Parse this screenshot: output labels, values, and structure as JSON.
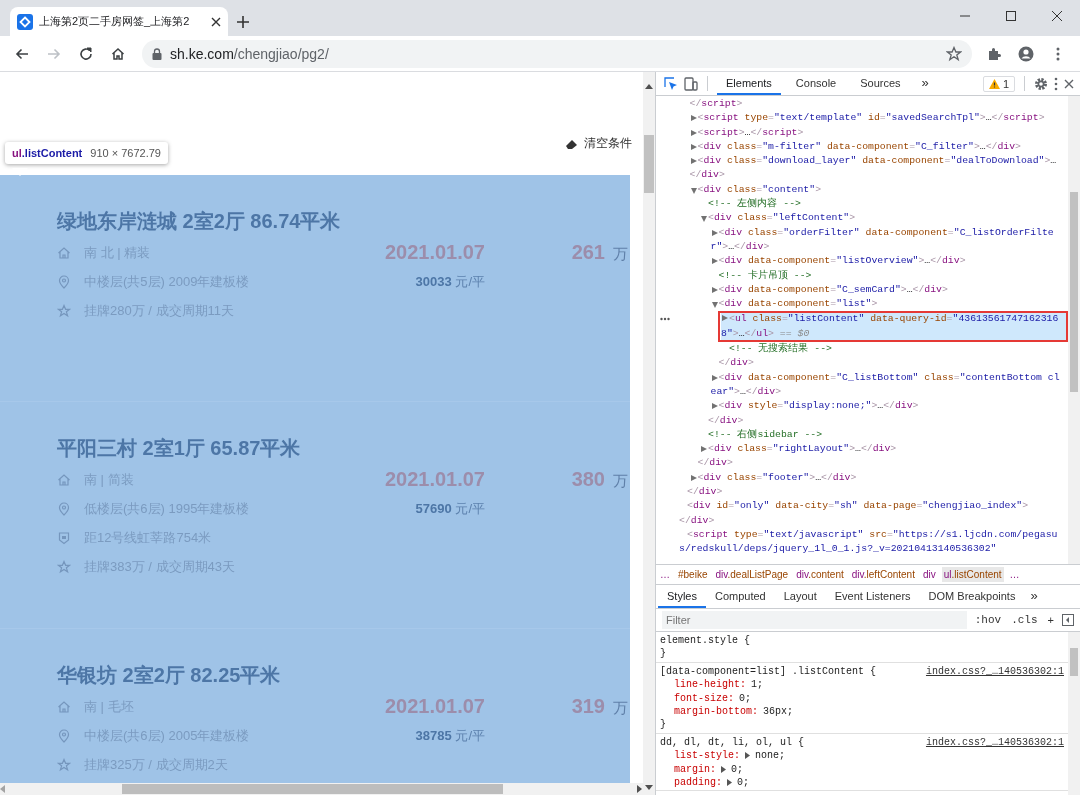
{
  "browser": {
    "tab": {
      "title": "上海第2页二手房网签_上海第2"
    },
    "nav": [
      {
        "kind": "back",
        "disabled": false
      },
      {
        "kind": "forward",
        "disabled": true
      },
      {
        "kind": "reload",
        "disabled": false
      },
      {
        "kind": "home",
        "disabled": false
      }
    ],
    "address": {
      "domain": "sh.ke.com",
      "path": "/chengjiao/pg2/"
    }
  },
  "page": {
    "clear_filters": "清空条件",
    "inspect_tooltip": {
      "selector": "ul.listContent",
      "size": "910 × 7672.79"
    },
    "listings": [
      {
        "title": "绿地东岸涟城 2室2厅 86.74平米",
        "rows": [
          {
            "kind": "house",
            "text": "南 北 | 精装"
          },
          {
            "kind": "location",
            "text": "中楼层(共5层) 2009年建板楼"
          },
          {
            "kind": "star",
            "text": "挂牌280万 / 成交周期11天"
          }
        ],
        "deal_date": "2021.01.07",
        "price": "261",
        "price_unit": "万",
        "unit_price": "30033",
        "unit_price_suffix": "元/平"
      },
      {
        "title": "平阳三村 2室1厅 65.87平米",
        "rows": [
          {
            "kind": "house",
            "text": "南 | 简装"
          },
          {
            "kind": "location",
            "text": "低楼层(共6层) 1995年建板楼"
          },
          {
            "kind": "subway",
            "text": "距12号线虹莘路754米"
          },
          {
            "kind": "star",
            "text": "挂牌383万 / 成交周期43天"
          }
        ],
        "deal_date": "2021.01.07",
        "price": "380",
        "price_unit": "万",
        "unit_price": "57690",
        "unit_price_suffix": "元/平"
      },
      {
        "title": "华银坊 2室2厅 82.25平米",
        "rows": [
          {
            "kind": "house",
            "text": "南 | 毛坯"
          },
          {
            "kind": "location",
            "text": "中楼层(共6层) 2005年建板楼"
          },
          {
            "kind": "star",
            "text": "挂牌325万 / 成交周期2天"
          }
        ],
        "deal_date": "2021.01.07",
        "price": "319",
        "price_unit": "万",
        "unit_price": "38785",
        "unit_price_suffix": "元/平"
      }
    ]
  },
  "devtools": {
    "tabs": [
      {
        "label": "Elements",
        "selected": true
      },
      {
        "label": "Console",
        "selected": false
      },
      {
        "label": "Sources",
        "selected": false
      }
    ],
    "more_tabs": "»",
    "warnings": "1",
    "dom": [
      {
        "children": [
          {
            "kind": "continuation",
            "selected": false,
            "lines": [
              "</script>"
            ]
          },
          {
            "kind": "element",
            "expanded": false,
            "selected": false,
            "lines": [
              "<script type=\"text/template\" id=\"savedSearchTpl\">…</script>"
            ]
          },
          {
            "kind": "element",
            "expanded": false,
            "selected": false,
            "lines": [
              "<script>…</script>"
            ]
          },
          {
            "kind": "element",
            "expanded": false,
            "selected": false,
            "lines": [
              "<div class=\"m-filter\" data-component=\"C_filter\">…</div>"
            ]
          },
          {
            "kind": "element",
            "expanded": false,
            "selected": false,
            "lines": [
              "<div class=\"download_layer\" data-component=\"dealToDownload\">…",
              "</div>"
            ]
          },
          {
            "kind": "element",
            "expanded": true,
            "selected": false,
            "lines": [
              "<div class=\"content\">"
            ],
            "closing": "</div>",
            "children": [
              {
                "kind": "comment",
                "selected": false,
                "lines": [
                  "<!-- 左侧内容 -->"
                ]
              },
              {
                "kind": "element",
                "expanded": true,
                "selected": false,
                "lines": [
                  "<div class=\"leftContent\">"
                ],
                "closing": "</div>",
                "children": [
                  {
                    "kind": "element",
                    "expanded": false,
                    "selected": false,
                    "lines": [
                      "<div class=\"orderFilter\" data-component=\"C_listOrderFilte",
                      "r\">…</div>"
                    ]
                  },
                  {
                    "kind": "element",
                    "expanded": false,
                    "selected": false,
                    "lines": [
                      "<div data-component=\"listOverview\">…</div>"
                    ]
                  },
                  {
                    "kind": "comment",
                    "selected": false,
                    "lines": [
                      "<!-- 卡片吊顶 -->"
                    ]
                  },
                  {
                    "kind": "element",
                    "expanded": false,
                    "selected": false,
                    "lines": [
                      "<div data-component=\"C_semCard\">…</div>"
                    ]
                  },
                  {
                    "kind": "element",
                    "expanded": true,
                    "selected": false,
                    "lines": [
                      "<div data-component=\"list\">"
                    ],
                    "closing": "</div>",
                    "children": [
                      {
                        "kind": "element",
                        "expanded": false,
                        "selected": true,
                        "lines": [
                          "<ul class=\"listContent\" data-query-id=\"43613561747162316",
                          "8\">…</ul>"
                        ],
                        "suffix": "== $0"
                      },
                      {
                        "kind": "comment",
                        "selected": false,
                        "lines": [
                          "<!-- 无搜索结果 -->"
                        ]
                      }
                    ]
                  },
                  {
                    "kind": "element",
                    "expanded": false,
                    "selected": false,
                    "lines": [
                      "<div data-component=\"C_listBottom\" class=\"contentBottom cl",
                      "ear\">…</div>"
                    ]
                  },
                  {
                    "kind": "element",
                    "expanded": false,
                    "selected": false,
                    "lines": [
                      "<div style=\"display:none;\">…</div>"
                    ]
                  }
                ]
              },
              {
                "kind": "comment",
                "selected": false,
                "lines": [
                  "<!-- 右侧sidebar -->"
                ]
              },
              {
                "kind": "element",
                "expanded": false,
                "selected": false,
                "lines": [
                  "<div class=\"rightLayout\">…</div>"
                ]
              }
            ]
          },
          {
            "kind": "element",
            "expanded": false,
            "selected": false,
            "lines": [
              "<div class=\"footer\">…</div>"
            ]
          }
        ],
        "closing": "</div>"
      },
      {
        "kind": "element",
        "selected": false,
        "lines": [
          "<div id=\"only\" data-city=\"sh\" data-page=\"chengjiao_index\">",
          "</div>"
        ]
      },
      {
        "kind": "element",
        "selected": false,
        "lines": [
          "<script type=\"text/javascript\" src=\"https://s1.ljcdn.com/pegasu",
          "s/redskull/deps/jquery_1l_0_1.js?_v=20210413140536302\""
        ]
      }
    ],
    "breadcrumbs": [
      {
        "text": "…",
        "selected": false
      },
      {
        "text": "#beike",
        "selected": false
      },
      {
        "text": "div.dealListPage",
        "selected": false
      },
      {
        "text": "div.content",
        "selected": false
      },
      {
        "text": "div.leftContent",
        "selected": false
      },
      {
        "text": "div",
        "selected": false
      },
      {
        "text": "ul.listContent",
        "selected": true
      },
      {
        "text": "…",
        "selected": false
      }
    ],
    "sidebar_tabs": [
      {
        "label": "Styles",
        "selected": true
      },
      {
        "label": "Computed",
        "selected": false
      },
      {
        "label": "Layout",
        "selected": false
      },
      {
        "label": "Event Listeners",
        "selected": false
      },
      {
        "label": "DOM Breakpoints",
        "selected": false
      }
    ],
    "more_sidebar_tabs": "»",
    "filter": {
      "placeholder": "Filter"
    },
    "hov": ":hov",
    "cls": ".cls",
    "add": "+",
    "rules": [
      {
        "selector": "element.style {",
        "close": "}"
      },
      {
        "selector": "[data-component=list] .listContent {",
        "source": "index.css?_…140536302:1",
        "declarations": [
          {
            "property": "line-height:",
            "value": "1;",
            "expandable": false
          },
          {
            "property": "font-size:",
            "value": "0;",
            "expandable": false
          },
          {
            "property": "margin-bottom:",
            "value": "36px;",
            "expandable": false
          }
        ],
        "close": "}"
      },
      {
        "selector": "dd, dl, dt, li, ol, ul {",
        "source": "index.css?_…140536302:1",
        "declarations": [
          {
            "property": "list-style:",
            "value": "none;",
            "expandable": true
          },
          {
            "property": "margin:",
            "value": "0;",
            "expandable": true
          },
          {
            "property": "padding:",
            "value": "0;",
            "expandable": true
          }
        ]
      }
    ]
  }
}
